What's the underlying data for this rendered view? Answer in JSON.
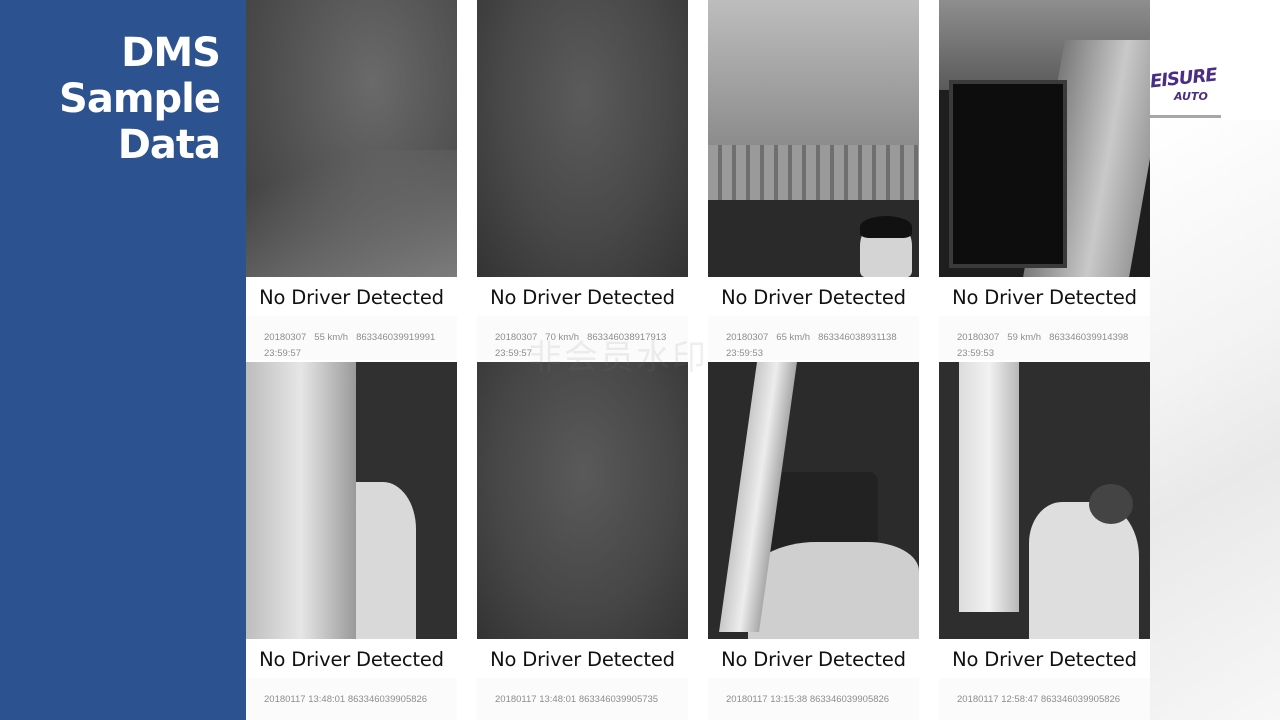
{
  "slide": {
    "title_lines": [
      "DMS",
      "Sample",
      "Data"
    ],
    "accent_color": "#2c5390"
  },
  "logo": {
    "line1": "EISURE",
    "line2": "AUTO",
    "color": "#4a2d86"
  },
  "watermark": "非会员水印",
  "tiles": [
    {
      "caption": "No Driver Detected",
      "date": "20180307",
      "speed": "55 km/h",
      "device": "863346039919991",
      "time": "23:59:57"
    },
    {
      "caption": "No Driver Detected",
      "date": "20180307",
      "speed": "70 km/h",
      "device": "863346038917913",
      "time": "23:59:57"
    },
    {
      "caption": "No Driver Detected",
      "date": "20180307",
      "speed": "65 km/h",
      "device": "863346038931138",
      "time": "23:59:53"
    },
    {
      "caption": "No Driver Detected",
      "date": "20180307",
      "speed": "59 km/h",
      "device": "863346039914398",
      "time": "23:59:53"
    },
    {
      "caption": "No Driver Detected",
      "stamp": "20180117 13:48:01",
      "device": "863346039905826"
    },
    {
      "caption": "No Driver Detected",
      "stamp": "20180117 13:48:01",
      "device": "863346039905735"
    },
    {
      "caption": "No Driver Detected",
      "stamp": "20180117 13:15:38",
      "device": "863346039905826"
    },
    {
      "caption": "No Driver Detected",
      "stamp": "20180117 12:58:47",
      "device": "863346039905826"
    }
  ]
}
